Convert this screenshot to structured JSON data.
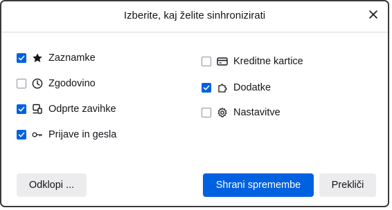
{
  "dialog": {
    "title": "Izberite, kaj želite sinhronizirati",
    "close_icon": "close-icon"
  },
  "options": {
    "left": [
      {
        "label": "Zaznamke",
        "checked": true,
        "icon": "star-icon"
      },
      {
        "label": "Zgodovino",
        "checked": false,
        "icon": "clock-icon"
      },
      {
        "label": "Odprte zavihke",
        "checked": true,
        "icon": "synced-tabs-icon"
      },
      {
        "label": "Prijave in gesla",
        "checked": true,
        "icon": "key-icon"
      }
    ],
    "right": [
      {
        "label": "Kreditne kartice",
        "checked": false,
        "icon": "credit-card-icon"
      },
      {
        "label": "Dodatke",
        "checked": true,
        "icon": "puzzle-piece-icon"
      },
      {
        "label": "Nastavitve",
        "checked": false,
        "icon": "gear-icon"
      }
    ]
  },
  "buttons": {
    "disconnect": "Odklopi ...",
    "save": "Shrani spremembe",
    "cancel": "Prekliči"
  },
  "colors": {
    "accent": "#0061e0",
    "secondary_button": "#ececee"
  }
}
